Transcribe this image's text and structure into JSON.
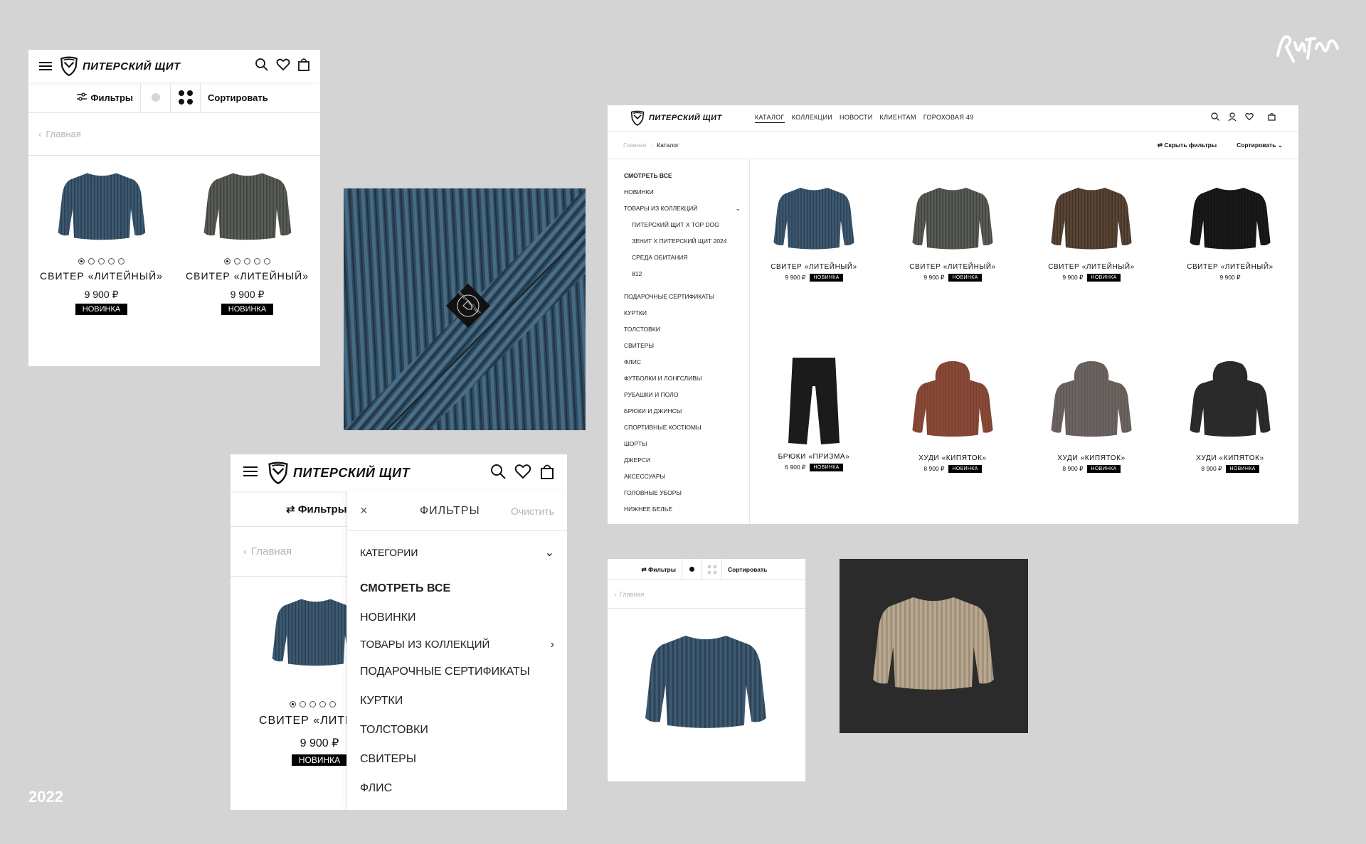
{
  "brand": {
    "name": "ПИТЕРСКИЙ ЩИТ",
    "signature": "Ритм"
  },
  "year": "2022",
  "mobile_top": {
    "filters_label": "Фильтры",
    "sort_label": "Сортировать",
    "back_label": "Главная",
    "products": [
      {
        "name": "СВИТЕР «ЛИТЕЙНЫЙ»",
        "price": "9 900 ₽",
        "badge": "НОВИНКА",
        "color": "#3d5a73"
      },
      {
        "name": "СВИТЕР «ЛИТЕЙНЫЙ»",
        "price": "9 900 ₽",
        "badge": "НОВИНКА",
        "color": "#5a5d57"
      }
    ]
  },
  "fabric_tag_text": "ПИТЕРСКИЙ ЩИТ",
  "desktop": {
    "nav": [
      "КАТАЛОГ",
      "КОЛЛЕКЦИИ",
      "НОВОСТИ",
      "КЛИЕНТАМ",
      "ГОРОХОВАЯ 49"
    ],
    "breadcrumb": {
      "home": "Главная",
      "sep": "·",
      "current": "Каталог"
    },
    "hide_filters": "Скрыть фильтры",
    "sort": "Сортировать",
    "sidebar": {
      "top": [
        "СМОТРЕТЬ ВСЕ",
        "НОВИНКИ",
        "ТОВАРЫ ИЗ КОЛЛЕКЦИЙ"
      ],
      "sub": [
        "ПИТЕРСКИЙ ЩИТ X TOP DOG",
        "ЗЕНИТ X ПИТЕРСКИЙ ЩИТ 2024",
        "СРЕДА ОБИТАНИЯ",
        "812"
      ],
      "rest": [
        "ПОДАРОЧНЫЕ СЕРТИФИКАТЫ",
        "КУРТКИ",
        "ТОЛСТОВКИ",
        "СВИТЕРЫ",
        "ФЛИС",
        "ФУТБОЛКИ И ЛОНГСЛИВЫ",
        "РУБАШКИ И ПОЛО",
        "БРЮКИ И ДЖИНСЫ",
        "СПОРТИВНЫЕ КОСТЮМЫ",
        "ШОРТЫ",
        "ДЖЕРСИ",
        "АКСЕССУАРЫ",
        "ГОЛОВНЫЕ УБОРЫ",
        "НИЖНЕЕ БЕЛЬЕ"
      ]
    },
    "products": [
      {
        "name": "СВИТЕР «ЛИТЕЙНЫЙ»",
        "price": "9 900 ₽",
        "badge": "НОВИНКА",
        "kind": "sweater",
        "color": "#3d5a73"
      },
      {
        "name": "СВИТЕР «ЛИТЕЙНЫЙ»",
        "price": "9 900 ₽",
        "badge": "НОВИНКА",
        "kind": "sweater",
        "color": "#5a5d57"
      },
      {
        "name": "СВИТЕР «ЛИТЕЙНЫЙ»",
        "price": "9 900 ₽",
        "badge": "НОВИНКА",
        "kind": "sweater",
        "color": "#5b4636"
      },
      {
        "name": "СВИТЕР «ЛИТЕЙНЫЙ»",
        "price": "9 900 ₽",
        "badge": "",
        "kind": "sweater",
        "color": "#1a1a1a"
      },
      {
        "name": "БРЮКИ «ПРИЗМА»",
        "price": "6 900 ₽",
        "badge": "НОВИНКА",
        "kind": "pants",
        "color": "#1b1b1b"
      },
      {
        "name": "ХУДИ «КИПЯТОК»",
        "price": "8 900 ₽",
        "badge": "НОВИНКА",
        "kind": "hoodie",
        "color": "#8a4a38"
      },
      {
        "name": "ХУДИ «КИПЯТОК»",
        "price": "8 900 ₽",
        "badge": "НОВИНКА",
        "kind": "hoodie",
        "color": "#6c6461"
      },
      {
        "name": "ХУДИ «КИПЯТОК»",
        "price": "8 900 ₽",
        "badge": "НОВИНКА",
        "kind": "hoodie",
        "color": "#2c2c2c"
      }
    ]
  },
  "mobile_filters": {
    "filters_label": "Фильтры",
    "back_label": "Главная",
    "product": {
      "name": "СВИТЕР «ЛИТЕЙ",
      "price": "9 900 ₽",
      "badge": "НОВИНКА"
    },
    "drawer": {
      "title": "ФИЛЬТРЫ",
      "clear": "Очистить",
      "section": "КАТЕГОРИИ",
      "items": [
        "СМОТРЕТЬ ВСЕ",
        "НОВИНКИ",
        "ТОВАРЫ ИЗ КОЛЛЕКЦИЙ",
        "ПОДАРОЧНЫЕ СЕРТИФИКАТЫ",
        "КУРТКИ",
        "ТОЛСТОВКИ",
        "СВИТЕРЫ",
        "ФЛИС"
      ]
    }
  },
  "mobile_single": {
    "filters_label": "Фильтры",
    "sort_label": "Сортировать",
    "back_label": "Главная"
  },
  "colors": {
    "background": "#d4d4d4",
    "beige_sweater": "#b9a88f",
    "dark_bg": "#2b2b2b"
  }
}
